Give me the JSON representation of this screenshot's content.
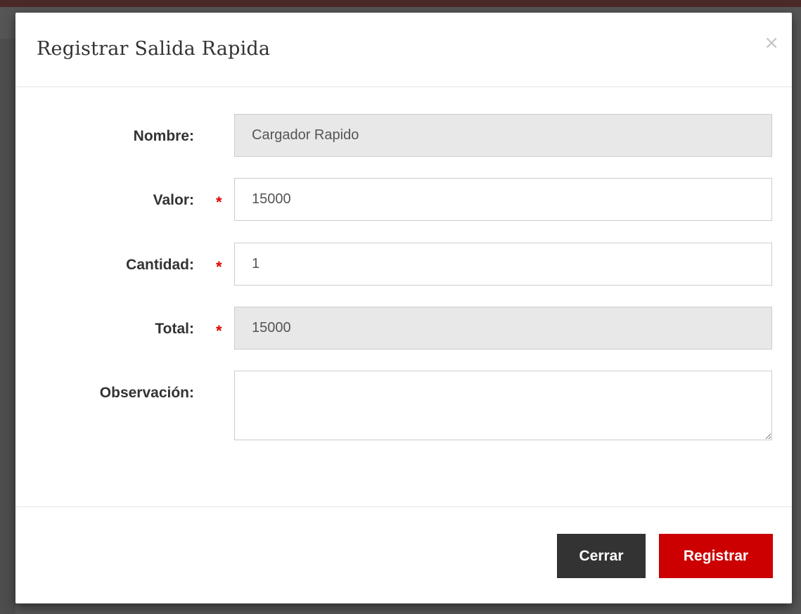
{
  "modal": {
    "title": "Registrar Salida Rapida",
    "close_symbol": "×"
  },
  "form": {
    "nombre": {
      "label": "Nombre:",
      "value": "Cargador Rapido",
      "required": false,
      "readonly": true
    },
    "valor": {
      "label": "Valor:",
      "value": "15000",
      "required": true,
      "readonly": false
    },
    "cantidad": {
      "label": "Cantidad:",
      "value": "1",
      "required": true,
      "readonly": false
    },
    "total": {
      "label": "Total:",
      "value": "15000",
      "required": true,
      "readonly": true
    },
    "observacion": {
      "label": "Observación:",
      "value": "",
      "required": false,
      "readonly": false
    },
    "required_symbol": "*"
  },
  "footer": {
    "close_label": "Cerrar",
    "register_label": "Registrar"
  },
  "colors": {
    "primary": "#cc0000",
    "secondary": "#333333",
    "required": "#e00000",
    "readonly_bg": "#e8e8e8"
  }
}
